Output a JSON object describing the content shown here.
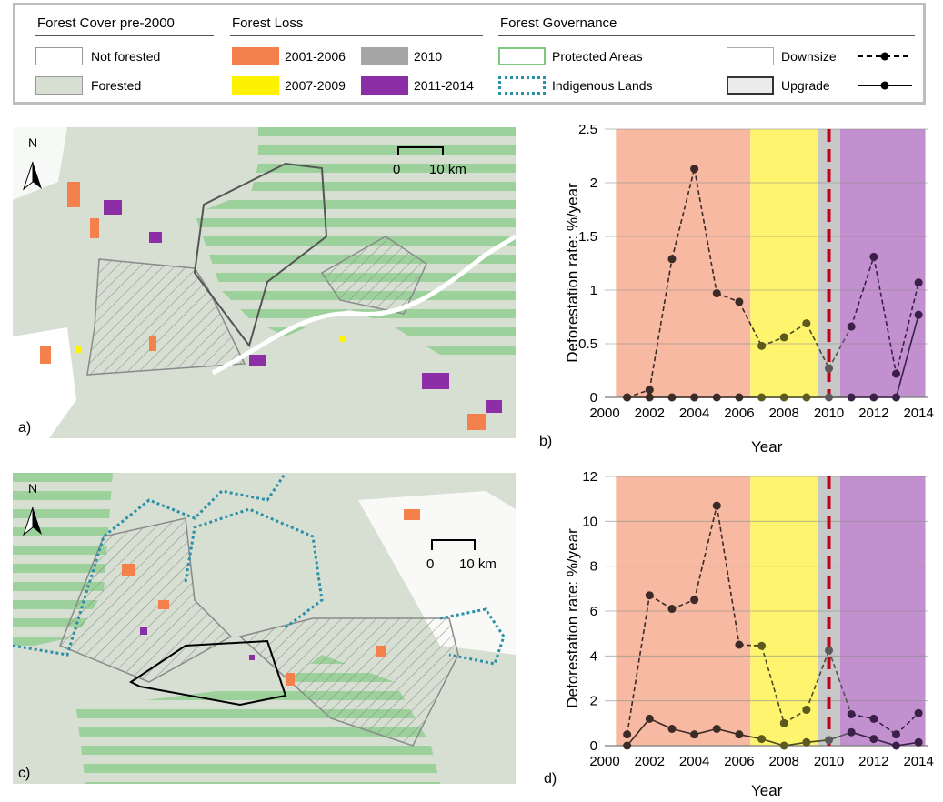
{
  "legend": {
    "cover_title": "Forest Cover pre-2000",
    "cover_items": [
      {
        "label": "Not forested",
        "color": "#ffffff"
      },
      {
        "label": "Forested",
        "color": "#d6dfd2"
      }
    ],
    "loss_title": "Forest Loss",
    "loss_items": [
      {
        "label": "2001-2006",
        "color": "#f4814b"
      },
      {
        "label": "2007-2009",
        "color": "#fff200"
      },
      {
        "label": "2010",
        "color": "#a6a6a6"
      },
      {
        "label": "2011-2014",
        "color": "#8c2fa6"
      }
    ],
    "gov_title": "Forest Governance",
    "gov_items": [
      {
        "label": "Protected Areas",
        "color": "#7fc97f"
      },
      {
        "label": "Indigenous Lands",
        "color": "#2b8fa8"
      },
      {
        "label": "Downsize"
      },
      {
        "label": "Upgrade"
      }
    ]
  },
  "maps": {
    "a": {
      "letter": "a)",
      "north": "N",
      "scale_start": "0",
      "scale_end": "10 km"
    },
    "c": {
      "letter": "c)",
      "north": "N",
      "scale_start": "0",
      "scale_end": "10 km"
    }
  },
  "colors": {
    "period_2001_2006": "#f7b9a1",
    "period_2007_2009": "#fff46e",
    "period_2010": "#c8c8c8",
    "period_2011_2014": "#c290cf",
    "event_line": "#c0001a",
    "protected_stripe": "#9cd19c",
    "indigenous": "#2b8fa8"
  },
  "chart_data": [
    {
      "type": "line",
      "letter": "b)",
      "xlabel": "Year",
      "ylabel": "Deforestation rate: %/year",
      "xlim": [
        2000,
        2014.4
      ],
      "ylim": [
        0,
        2.5
      ],
      "x_ticks": [
        "2000",
        "2002",
        "2004",
        "2006",
        "2008",
        "2010",
        "2012",
        "2014"
      ],
      "y_ticks": [
        "0",
        "0.5",
        "1",
        "1.5",
        "2",
        "2.5"
      ],
      "periods": [
        {
          "label": "2001-2006",
          "from": 2000.5,
          "to": 2006.5
        },
        {
          "label": "2007-2009",
          "from": 2006.5,
          "to": 2009.5
        },
        {
          "label": "2010",
          "from": 2009.5,
          "to": 2010.5
        },
        {
          "label": "2011-2014",
          "from": 2010.5,
          "to": 2014.3
        }
      ],
      "event_year": 2010,
      "series": [
        {
          "name": "Downsize",
          "style": "dashed",
          "x": [
            2001,
            2002,
            2003,
            2004,
            2005,
            2006,
            2007,
            2008,
            2009,
            2010,
            2011,
            2012,
            2013,
            2014
          ],
          "values": [
            0,
            0.07,
            1.29,
            2.13,
            0.97,
            0.89,
            0.48,
            0.56,
            0.69,
            0.27,
            0.66,
            1.31,
            0.22,
            1.07
          ]
        },
        {
          "name": "Upgrade",
          "style": "solid",
          "x": [
            2001,
            2002,
            2003,
            2004,
            2005,
            2006,
            2007,
            2008,
            2009,
            2010,
            2011,
            2012,
            2013,
            2014
          ],
          "values": [
            0,
            0,
            0,
            0,
            0,
            0,
            0,
            0,
            0,
            0,
            0,
            0,
            0,
            0.77
          ]
        }
      ]
    },
    {
      "type": "line",
      "letter": "d)",
      "xlabel": "Year",
      "ylabel": "Deforestation rate: %/year",
      "xlim": [
        2000,
        2014.4
      ],
      "ylim": [
        0,
        12
      ],
      "x_ticks": [
        "2000",
        "2002",
        "2004",
        "2006",
        "2008",
        "2010",
        "2012",
        "2014"
      ],
      "y_ticks": [
        "0",
        "2",
        "4",
        "6",
        "8",
        "10",
        "12"
      ],
      "periods": [
        {
          "label": "2001-2006",
          "from": 2000.5,
          "to": 2006.5
        },
        {
          "label": "2007-2009",
          "from": 2006.5,
          "to": 2009.5
        },
        {
          "label": "2010",
          "from": 2009.5,
          "to": 2010.5
        },
        {
          "label": "2011-2014",
          "from": 2010.5,
          "to": 2014.3
        }
      ],
      "event_year": 2010,
      "series": [
        {
          "name": "Downsize",
          "style": "dashed",
          "x": [
            2001,
            2002,
            2003,
            2004,
            2005,
            2006,
            2007,
            2008,
            2009,
            2010,
            2011,
            2012,
            2013,
            2014
          ],
          "values": [
            0.5,
            6.7,
            6.1,
            6.5,
            10.7,
            4.5,
            4.45,
            1.0,
            1.6,
            4.25,
            1.4,
            1.2,
            0.5,
            1.45
          ]
        },
        {
          "name": "Upgrade",
          "style": "solid",
          "x": [
            2001,
            2002,
            2003,
            2004,
            2005,
            2006,
            2007,
            2008,
            2009,
            2010,
            2011,
            2012,
            2013,
            2014
          ],
          "values": [
            0,
            1.2,
            0.75,
            0.5,
            0.75,
            0.5,
            0.3,
            0,
            0.15,
            0.25,
            0.6,
            0.3,
            0,
            0.15
          ]
        }
      ]
    }
  ]
}
